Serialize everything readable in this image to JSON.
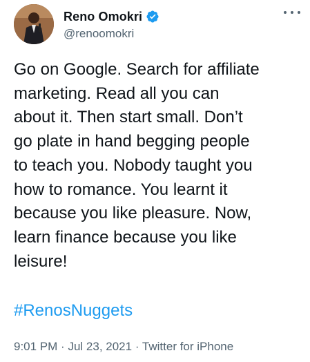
{
  "author": {
    "display_name": "Reno Omokri",
    "handle": "@renoomokri",
    "verified": true,
    "avatar_icon": "profile-photo"
  },
  "more_icon": "ellipsis-icon",
  "tweet": {
    "text": "Go on Google. Search for affiliate\nmarketing. Read all you can\nabout it. Then start small. Don’t\ngo plate in hand begging people\nto teach you. Nobody taught you\nhow to romance. You learnt it\nbecause you like pleasure. Now,\nlearn finance because you like\nleisure!",
    "hashtag": "#RenosNuggets"
  },
  "meta": {
    "time": "9:01 PM",
    "separator": "·",
    "date": "Jul 23, 2021",
    "source": "Twitter for iPhone"
  },
  "colors": {
    "text": "#0f1419",
    "secondary": "#536471",
    "link": "#1d9bf0",
    "verified_badge": "#1d9bf0"
  }
}
